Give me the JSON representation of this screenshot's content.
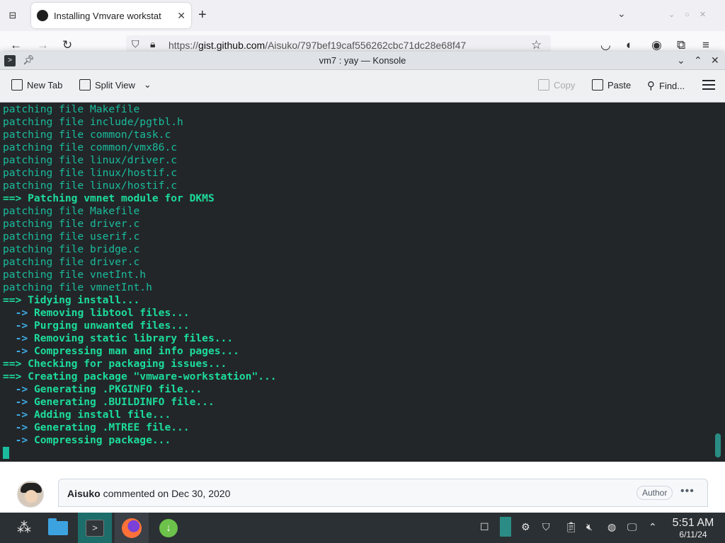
{
  "browser": {
    "tab_title": "Installing Vmvare workstat",
    "url_prefix": "https://",
    "url_host": "gist.github.com",
    "url_path": "/Aisuko/797bef19caf556262cbc71dc28e68f47"
  },
  "konsole": {
    "window_title": "vm7 : yay — Konsole",
    "toolbar": {
      "new_tab": "New Tab",
      "split_view": "Split View",
      "copy": "Copy",
      "paste": "Paste",
      "find": "Find..."
    },
    "lines": [
      {
        "prefix": "",
        "text": "patching file Makefile",
        "style": "plain"
      },
      {
        "prefix": "",
        "text": "patching file include/pgtbl.h",
        "style": "plain"
      },
      {
        "prefix": "",
        "text": "patching file common/task.c",
        "style": "plain"
      },
      {
        "prefix": "",
        "text": "patching file common/vmx86.c",
        "style": "plain"
      },
      {
        "prefix": "",
        "text": "patching file linux/driver.c",
        "style": "plain"
      },
      {
        "prefix": "",
        "text": "patching file linux/hostif.c",
        "style": "plain"
      },
      {
        "prefix": "",
        "text": "patching file linux/hostif.c",
        "style": "plain"
      },
      {
        "prefix": "==>",
        "text": " Patching vmnet module for DKMS",
        "style": "main"
      },
      {
        "prefix": "",
        "text": "patching file Makefile",
        "style": "plain"
      },
      {
        "prefix": "",
        "text": "patching file driver.c",
        "style": "plain"
      },
      {
        "prefix": "",
        "text": "patching file userif.c",
        "style": "plain"
      },
      {
        "prefix": "",
        "text": "patching file bridge.c",
        "style": "plain"
      },
      {
        "prefix": "",
        "text": "patching file driver.c",
        "style": "plain"
      },
      {
        "prefix": "",
        "text": "patching file vnetInt.h",
        "style": "plain"
      },
      {
        "prefix": "",
        "text": "patching file vmnetInt.h",
        "style": "plain"
      },
      {
        "prefix": "==>",
        "text": " Tidying install...",
        "style": "main"
      },
      {
        "prefix": "  ->",
        "text": " Removing libtool files...",
        "style": "sub"
      },
      {
        "prefix": "  ->",
        "text": " Purging unwanted files...",
        "style": "sub"
      },
      {
        "prefix": "  ->",
        "text": " Removing static library files...",
        "style": "sub"
      },
      {
        "prefix": "  ->",
        "text": " Compressing man and info pages...",
        "style": "sub"
      },
      {
        "prefix": "==>",
        "text": " Checking for packaging issues...",
        "style": "main"
      },
      {
        "prefix": "==>",
        "text": " Creating package \"vmware-workstation\"...",
        "style": "main"
      },
      {
        "prefix": "  ->",
        "text": " Generating .PKGINFO file...",
        "style": "sub"
      },
      {
        "prefix": "  ->",
        "text": " Generating .BUILDINFO file...",
        "style": "sub"
      },
      {
        "prefix": "  ->",
        "text": " Adding install file...",
        "style": "sub"
      },
      {
        "prefix": "  ->",
        "text": " Generating .MTREE file...",
        "style": "sub"
      },
      {
        "prefix": "  ->",
        "text": " Compressing package...",
        "style": "sub"
      }
    ]
  },
  "gist_comment": {
    "author": "Aisuko",
    "action": " commented on Dec 30, 2020",
    "badge": "Author"
  },
  "taskbar": {
    "time": "5:51 AM",
    "date": "6/11/24"
  },
  "colors": {
    "terminal_bg": "#232629",
    "terminal_text": "#1abc9c",
    "terminal_arrow_sub": "#3daee9",
    "taskbar_bg": "#2b3034"
  }
}
